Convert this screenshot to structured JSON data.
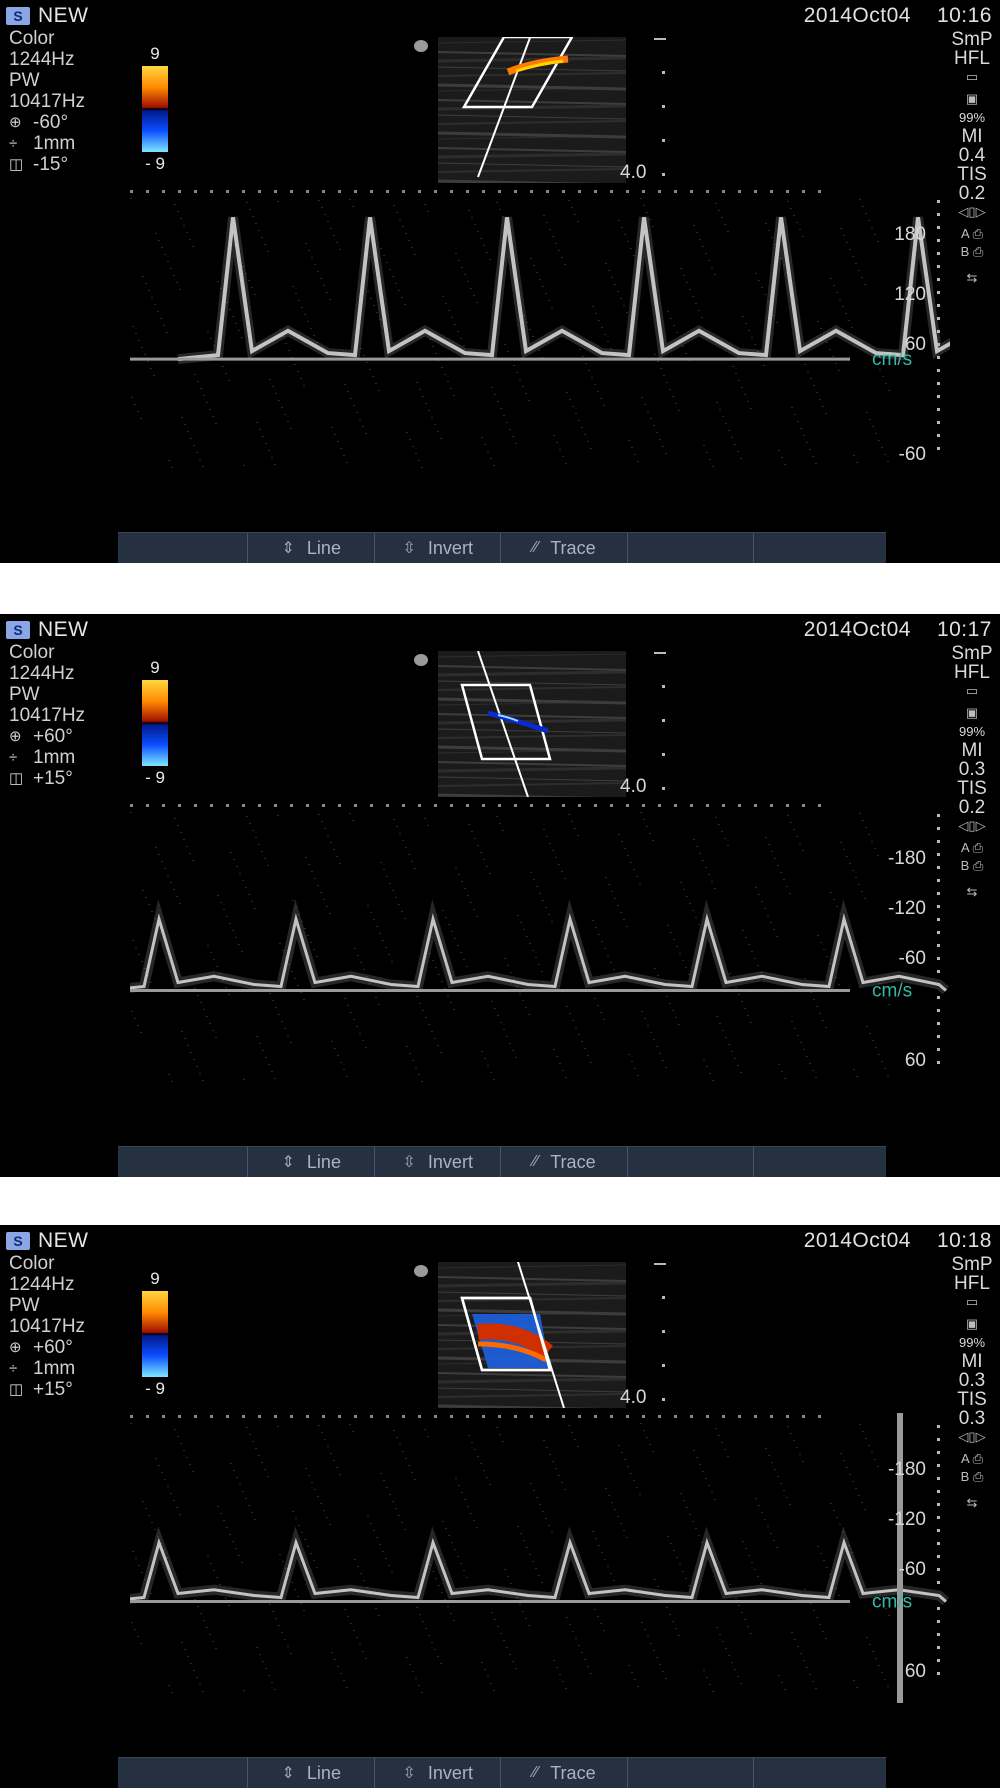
{
  "panels": [
    {
      "new_label": "NEW",
      "date": "2014Oct04",
      "time": "10:16",
      "params": {
        "mode1": "Color",
        "freq1": "1244Hz",
        "mode2": "PW",
        "freq2": "10417Hz",
        "angle": "-60°",
        "gate": "1mm",
        "steer": "-15°"
      },
      "scale": {
        "top": "9",
        "bottom": "- 9"
      },
      "right": {
        "preset": "SmP",
        "probe": "HFL",
        "power": "99%",
        "mi_label": "MI",
        "mi": "0.4",
        "tis_label": "TIS",
        "tis": "0.2",
        "a_label": "A",
        "b_label": "B"
      },
      "depth": "4.0",
      "axis": [
        "180",
        "120",
        "60",
        "-60"
      ],
      "unit": "cm/s",
      "flow": "red",
      "peak_level": 0.88,
      "baseline_frac": 0.59,
      "invert": false
    },
    {
      "new_label": "NEW",
      "date": "2014Oct04",
      "time": "10:17",
      "params": {
        "mode1": "Color",
        "freq1": "1244Hz",
        "mode2": "PW",
        "freq2": "10417Hz",
        "angle": "+60°",
        "gate": "1mm",
        "steer": "+15°"
      },
      "scale": {
        "top": "9",
        "bottom": "- 9"
      },
      "right": {
        "preset": "SmP",
        "probe": "HFL",
        "power": "99%",
        "mi_label": "MI",
        "mi": "0.3",
        "tis_label": "TIS",
        "tis": "0.2",
        "a_label": "A",
        "b_label": "B"
      },
      "depth": "4.0",
      "axis": [
        "-180",
        "-120",
        "-60",
        "60"
      ],
      "unit": "cm/s",
      "flow": "blue",
      "peak_level": 0.4,
      "baseline_frac": 0.65,
      "invert": true
    },
    {
      "new_label": "NEW",
      "date": "2014Oct04",
      "time": "10:18",
      "params": {
        "mode1": "Color",
        "freq1": "1244Hz",
        "mode2": "PW",
        "freq2": "10417Hz",
        "angle": "+60°",
        "gate": "1mm",
        "steer": "+15°"
      },
      "scale": {
        "top": "9",
        "bottom": "- 9"
      },
      "right": {
        "preset": "SmP",
        "probe": "HFL",
        "power": "99%",
        "mi_label": "MI",
        "mi": "0.3",
        "tis_label": "TIS",
        "tis": "0.3",
        "a_label": "A",
        "b_label": "B"
      },
      "depth": "4.0",
      "axis": [
        "-180",
        "-120",
        "-60",
        "60"
      ],
      "unit": "cm/s",
      "flow": "mixed",
      "peak_level": 0.33,
      "baseline_frac": 0.65,
      "invert": true
    }
  ],
  "toolbar": {
    "line": "Line",
    "invert": "Invert",
    "trace": "Trace"
  },
  "colors": {
    "accent_unit": "#2fb8a8",
    "toolbar_bg": "#253040",
    "toolbar_text": "#a9b3c2"
  }
}
